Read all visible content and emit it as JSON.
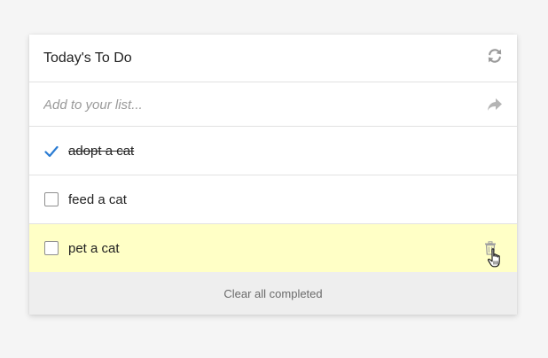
{
  "header": {
    "title": "Today's To Do",
    "refresh_icon": "refresh-icon"
  },
  "add_input": {
    "value": "",
    "placeholder": "Add to your list...",
    "submit_icon": "share-arrow-icon"
  },
  "items": [
    {
      "label": "adopt a cat",
      "completed": true
    },
    {
      "label": "feed a cat",
      "completed": false
    },
    {
      "label": "pet a cat",
      "completed": false,
      "highlighted": true,
      "hover_icon": "trash-icon"
    }
  ],
  "footer": {
    "clear_label": "Clear all completed"
  },
  "colors": {
    "check": "#2b7cd3",
    "highlight": "#ffffc6",
    "footer_bg": "#eeeeee",
    "icon": "#9a9a9a"
  }
}
